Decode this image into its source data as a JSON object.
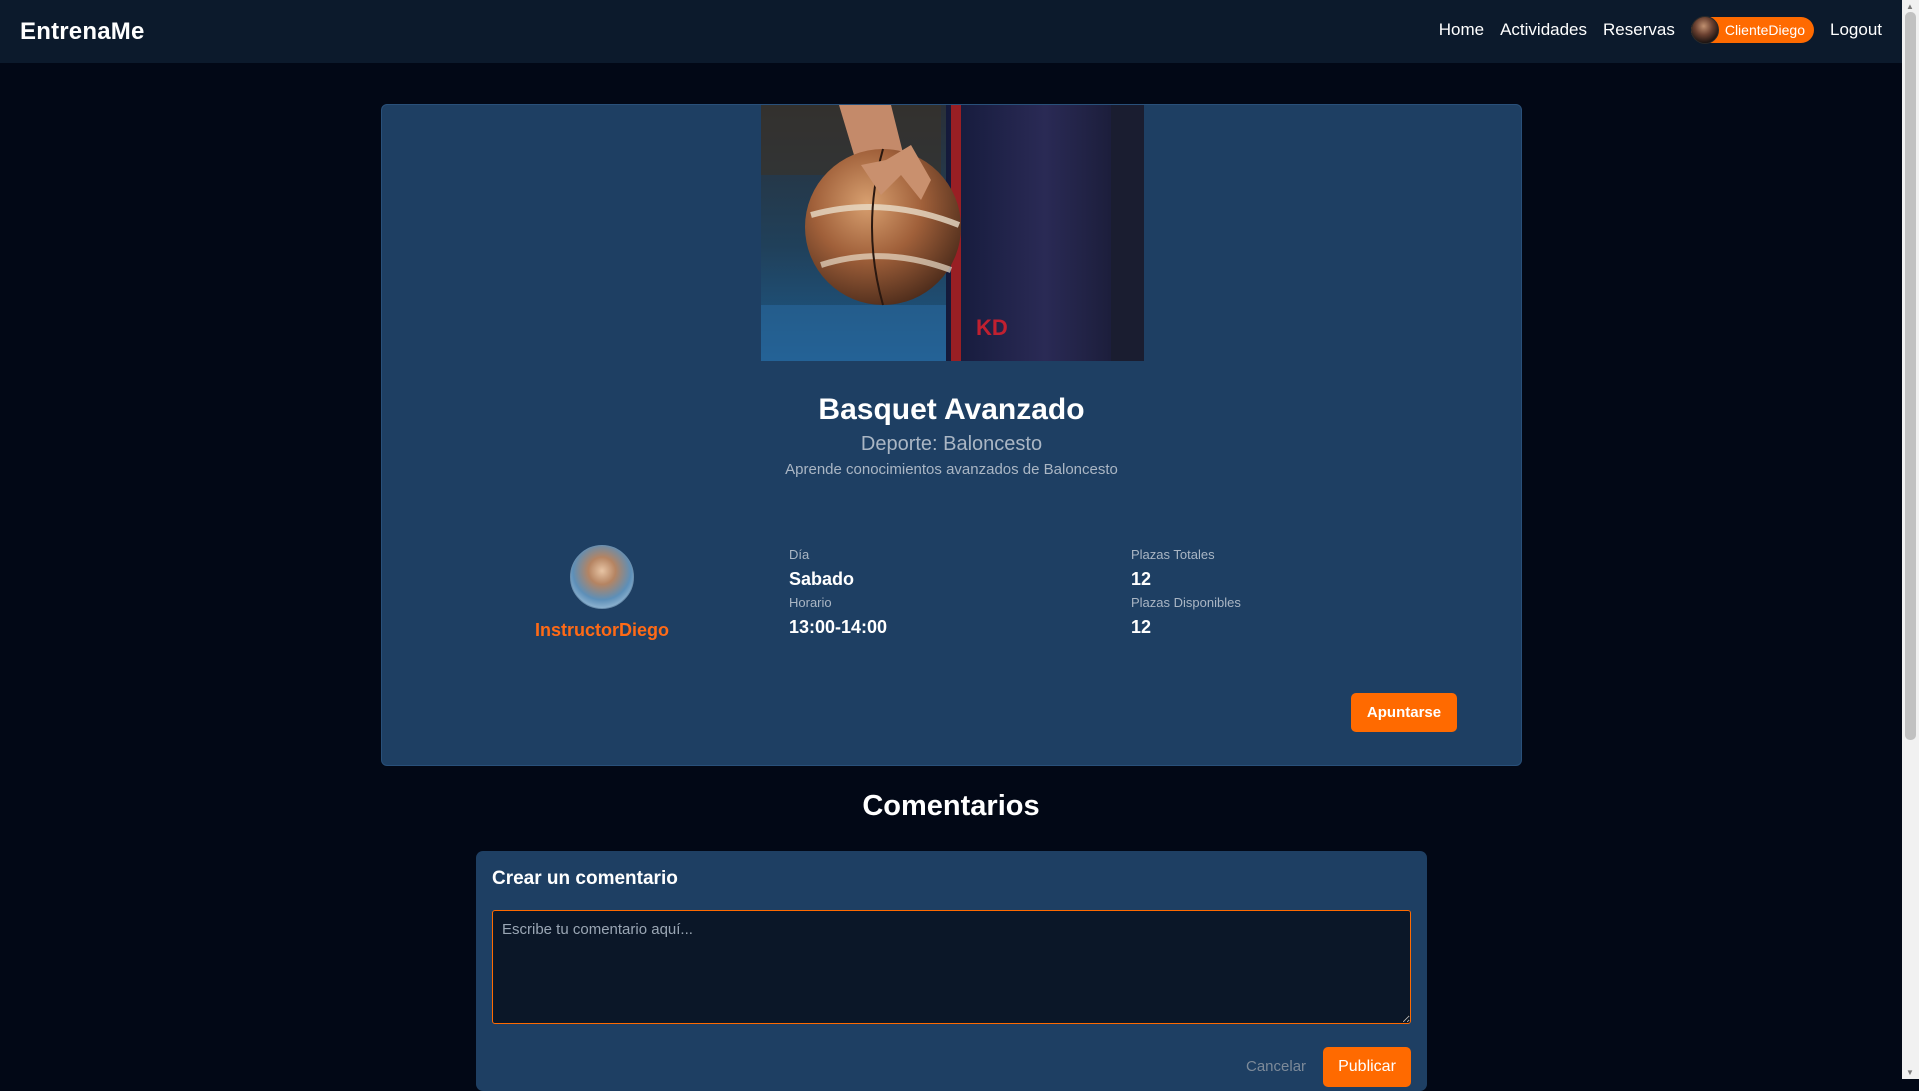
{
  "navbar": {
    "brand": "EntrenaMe",
    "links": [
      "Home",
      "Actividades",
      "Reservas"
    ],
    "user": "ClienteDiego",
    "logout": "Logout"
  },
  "activity": {
    "title": "Basquet Avanzado",
    "sport": "Deporte: Baloncesto",
    "description": "Aprende conocimientos avanzados de Baloncesto",
    "instructor": "InstructorDiego",
    "day_label": "Día",
    "day": "Sabado",
    "schedule_label": "Horario",
    "schedule": "13:00-14:00",
    "total_label": "Plazas Totales",
    "total": "12",
    "available_label": "Plazas Disponibles",
    "available": "12",
    "join_label": "Apuntarse"
  },
  "comments": {
    "title": "Comentarios",
    "create_heading": "Crear un comentario",
    "placeholder": "Escribe tu comentario aquí...",
    "cancel_label": "Cancelar",
    "publish_label": "Publicar"
  },
  "colors": {
    "accent": "#ff6a00",
    "navbar_bg": "#0c1a2c",
    "card_bg": "#1e3f63",
    "page_bg": "#020816"
  },
  "icons": {
    "user_avatar": "user-avatar-icon",
    "instructor_avatar": "instructor-avatar-icon",
    "hero_image": "basketball-photo"
  }
}
